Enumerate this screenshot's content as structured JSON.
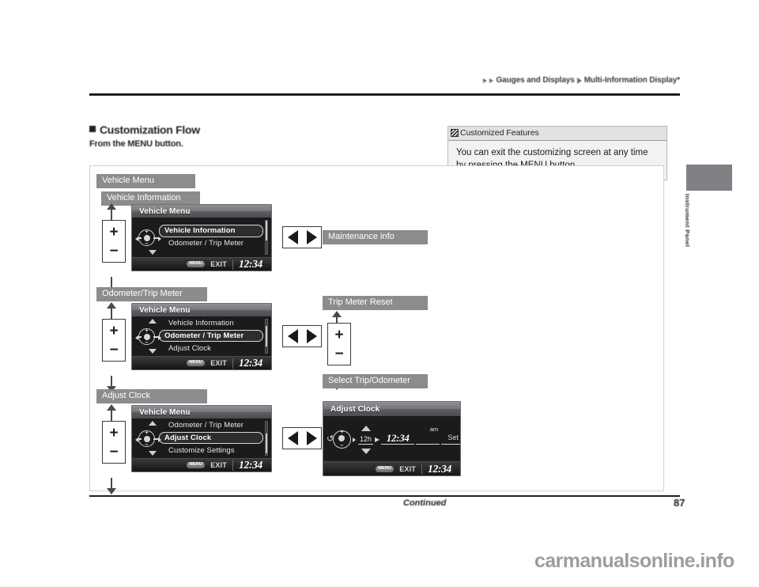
{
  "header": {
    "breadcrumb_1": "Gauges and Displays",
    "breadcrumb_2": "Multi-Information Display*"
  },
  "section": {
    "title": "Customization Flow",
    "subtitle": "From the MENU button."
  },
  "callout": {
    "title": "Customized Features",
    "body": "You can exit the customizing screen at any time by pressing the MENU button."
  },
  "diagram": {
    "ribbons": {
      "vehicle_menu": "Vehicle Menu",
      "vehicle_information": "Vehicle Information",
      "odometer_trip_meter": "Odometer/Trip Meter",
      "adjust_clock": "Adjust Clock",
      "maintenance_info": "Maintenance info",
      "trip_meter_reset": "Trip Meter Reset",
      "select_trip_odometer": "Select Trip/Odometer"
    },
    "plus_label": "+",
    "minus_label": "−",
    "screens": [
      {
        "id": "screen-vehicle-information",
        "title": "Vehicle Menu",
        "rows": [
          {
            "label": "",
            "state": "spacer"
          },
          {
            "label": "Vehicle Information",
            "state": "selected"
          },
          {
            "label": "Odometer / Trip Meter",
            "state": "normal"
          }
        ],
        "caret_up": false,
        "caret_down": true,
        "footer": {
          "menu_chip": "MENU",
          "exit": "EXIT",
          "clock": "12:34"
        }
      },
      {
        "id": "screen-odometer-trip-meter",
        "title": "Vehicle Menu",
        "rows": [
          {
            "label": "Vehicle Information",
            "state": "normal"
          },
          {
            "label": "Odometer / Trip Meter",
            "state": "selected"
          },
          {
            "label": "Adjust Clock",
            "state": "normal"
          }
        ],
        "caret_up": true,
        "caret_down": true,
        "footer": {
          "menu_chip": "MENU",
          "exit": "EXIT",
          "clock": "12:34"
        }
      },
      {
        "id": "screen-adjust-clock-menu",
        "title": "Vehicle Menu",
        "rows": [
          {
            "label": "Odometer / Trip Meter",
            "state": "normal"
          },
          {
            "label": "Adjust Clock",
            "state": "selected"
          },
          {
            "label": "Customize Settings",
            "state": "normal"
          }
        ],
        "caret_up": true,
        "caret_down": true,
        "footer": {
          "menu_chip": "MENU",
          "exit": "EXIT",
          "clock": "12:34"
        }
      }
    ],
    "clock_screen": {
      "id": "screen-adjust-clock",
      "title": "Adjust Clock",
      "format_field": "12h",
      "time_field": "12:34",
      "ampm": "am",
      "set_field": "Set",
      "footer": {
        "menu_chip": "MENU",
        "exit": "EXIT",
        "clock": "12:34"
      }
    }
  },
  "side_tab": {
    "label": "Instrument Panel"
  },
  "footer": {
    "continued": "Continued",
    "page_number": "87"
  },
  "watermark": "carmanualsonline.info",
  "colors": {
    "ribbon_grey": "#8a8c8e",
    "lcd_black": "#141414",
    "lcd_title_grey": "#75777b",
    "accent_dark": "#231f20"
  }
}
